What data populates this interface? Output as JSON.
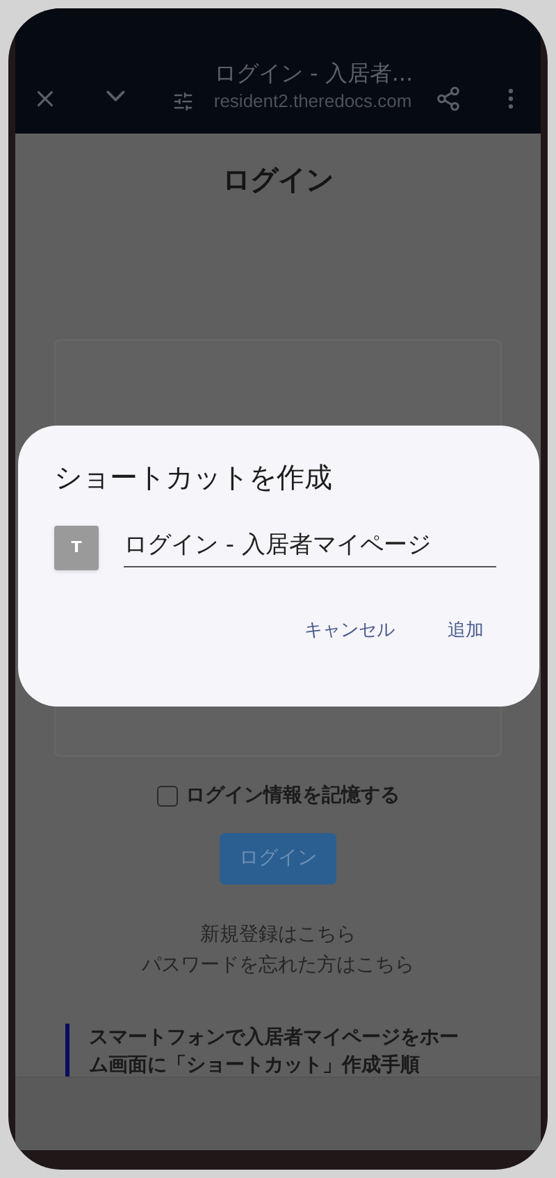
{
  "browser": {
    "title": "ログイン - 入居者...",
    "url": "resident2.theredocs.com"
  },
  "page": {
    "heading": "ログイン",
    "remember": {
      "label": "ログイン情報を記憶する",
      "checked": false
    },
    "login_button": "ログイン",
    "links": [
      "新規登録はこちら",
      "パスワードを忘れた方はこちら"
    ],
    "notice": "スマートフォンで入居者マイページをホーム画面に「ショートカット」作成手順"
  },
  "dialog": {
    "title": "ショートカットを作成",
    "icon_letter": "T",
    "name_value": "ログイン - 入居者マイページ",
    "buttons": [
      "キャンセル",
      "追加"
    ]
  }
}
